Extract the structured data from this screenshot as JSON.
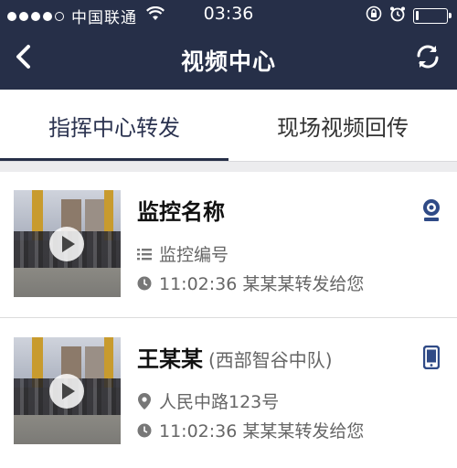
{
  "status_bar": {
    "carrier": "中国联通",
    "time": "03:36",
    "signal_filled": 4,
    "signal_total": 5
  },
  "nav": {
    "title": "视频中心",
    "back_icon": "chevron-left-icon",
    "refresh_icon": "refresh-icon"
  },
  "tabs": [
    {
      "label": "指挥中心转发",
      "active": true
    },
    {
      "label": "现场视频回传",
      "active": false
    }
  ],
  "items": [
    {
      "title": "监控名称",
      "subtitle": "",
      "meta1_icon": "list-icon",
      "meta1": "监控编号",
      "meta2_icon": "clock-icon",
      "meta2": "11:02:36 某某某转发给您",
      "type_icon": "webcam-icon"
    },
    {
      "title": "王某某",
      "subtitle": "(西部智谷中队)",
      "meta1_icon": "location-pin-icon",
      "meta1": "人民中路123号",
      "meta2_icon": "clock-icon",
      "meta2": "11:02:36 某某某转发给您",
      "type_icon": "mobile-phone-icon"
    }
  ],
  "colors": {
    "header_bg": "#262f48",
    "accent": "#2b3350",
    "icon_blue": "#2f4a86"
  }
}
